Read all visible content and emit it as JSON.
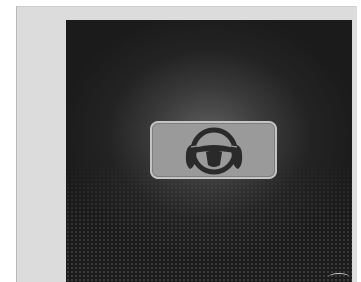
{
  "screen": {
    "indicator_icon": "steering-wheel-hands-on-icon",
    "colors": {
      "panel_background": "#dcdcdc",
      "display_background": "#1b1b1b",
      "indicator_fill": "#9a9a9a",
      "indicator_border": "#c4c4c4",
      "icon_color": "#2a2a2a"
    }
  }
}
